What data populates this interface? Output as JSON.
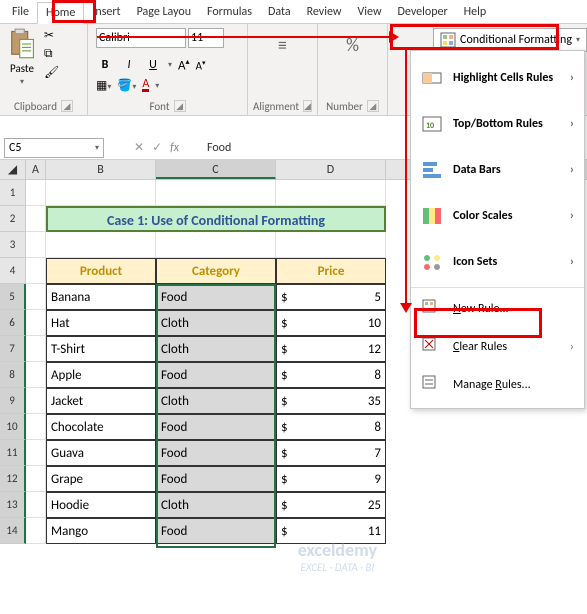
{
  "menu": {
    "tabs": [
      "File",
      "Home",
      "Insert",
      "Page Layou",
      "Formulas",
      "Data",
      "Review",
      "View",
      "Developer",
      "Help"
    ]
  },
  "ribbon": {
    "paste": "Paste",
    "clipboard_label": "Clipboard",
    "font_name": "Calibri",
    "font_size": "11",
    "font_label": "Font",
    "align_label": "Alignment",
    "number_label": "Number",
    "percent": "%",
    "cond_fmt": "Conditional Formatting",
    "bold": "B",
    "italic": "I",
    "underline": "U"
  },
  "menu_items": {
    "highlight": "Highlight Cells Rules",
    "topbottom": "Top/Bottom Rules",
    "databars": "Data Bars",
    "colorscales": "Color Scales",
    "iconsets": "Icon Sets",
    "newrule": "New Rule...",
    "clear": "Clear Rules",
    "manage": "Manage Rules..."
  },
  "namebox": {
    "ref": "C5",
    "formula": "Food"
  },
  "sheet": {
    "title": "Case 1: Use of Conditional Formatting",
    "headers": {
      "product": "Product",
      "category": "Category",
      "price": "Price"
    },
    "rows": [
      {
        "product": "Banana",
        "category": "Food",
        "price": "5"
      },
      {
        "product": "Hat",
        "category": "Cloth",
        "price": "10"
      },
      {
        "product": "T-Shirt",
        "category": "Cloth",
        "price": "12"
      },
      {
        "product": "Apple",
        "category": "Food",
        "price": "8"
      },
      {
        "product": "Jacket",
        "category": "Cloth",
        "price": "35"
      },
      {
        "product": "Chocolate",
        "category": "Food",
        "price": "8"
      },
      {
        "product": "Guava",
        "category": "Food",
        "price": "7"
      },
      {
        "product": "Grape",
        "category": "Food",
        "price": "9"
      },
      {
        "product": "Hoodie",
        "category": "Cloth",
        "price": "25"
      },
      {
        "product": "Mango",
        "category": "Food",
        "price": "11"
      }
    ],
    "currency": "$",
    "cols": [
      "A",
      "B",
      "C",
      "D"
    ],
    "rownums": [
      "1",
      "2",
      "3",
      "4",
      "5",
      "6",
      "7",
      "8",
      "9",
      "10",
      "11",
      "12",
      "13",
      "14"
    ]
  },
  "watermark": {
    "line1": "exceldemy",
    "line2": "EXCEL · DATA · BI"
  }
}
